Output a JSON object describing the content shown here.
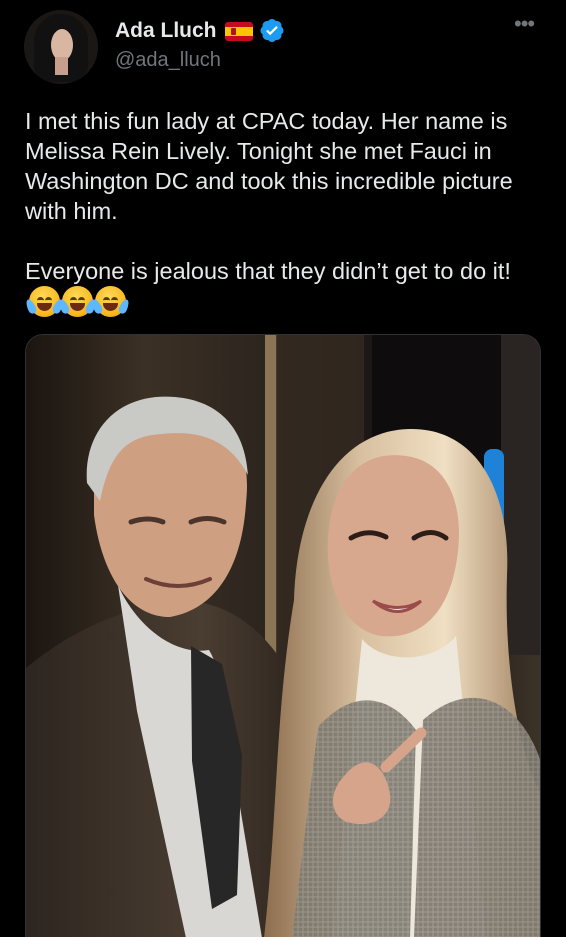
{
  "user": {
    "display_name": "Ada Lluch",
    "handle": "@ada_lluch",
    "flag": "spain-flag-icon",
    "verified": true,
    "verified_icon": "verified-badge-icon",
    "avatar": "profile-avatar"
  },
  "tweet": {
    "paragraphs": [
      "I met this fun lady at CPAC today. Her name is Melissa Rein Lively. Tonight she met Fauci in Washington DC and took this incredible picture with him.",
      "Everyone is jealous that they didn’t get to do it!"
    ],
    "emoji": [
      "face-with-tears-of-joy-icon",
      "face-with-tears-of-joy-icon",
      "face-with-tears-of-joy-icon"
    ]
  },
  "media": {
    "type": "photo",
    "subjects": [
      "older man in suit",
      "woman with long blonde hair"
    ]
  },
  "colors": {
    "background": "#000000",
    "primary_text": "#e7e9ea",
    "secondary_text": "#71767b",
    "verified_blue": "#1d9bf0"
  },
  "icons": {
    "more": "more-options-icon"
  }
}
